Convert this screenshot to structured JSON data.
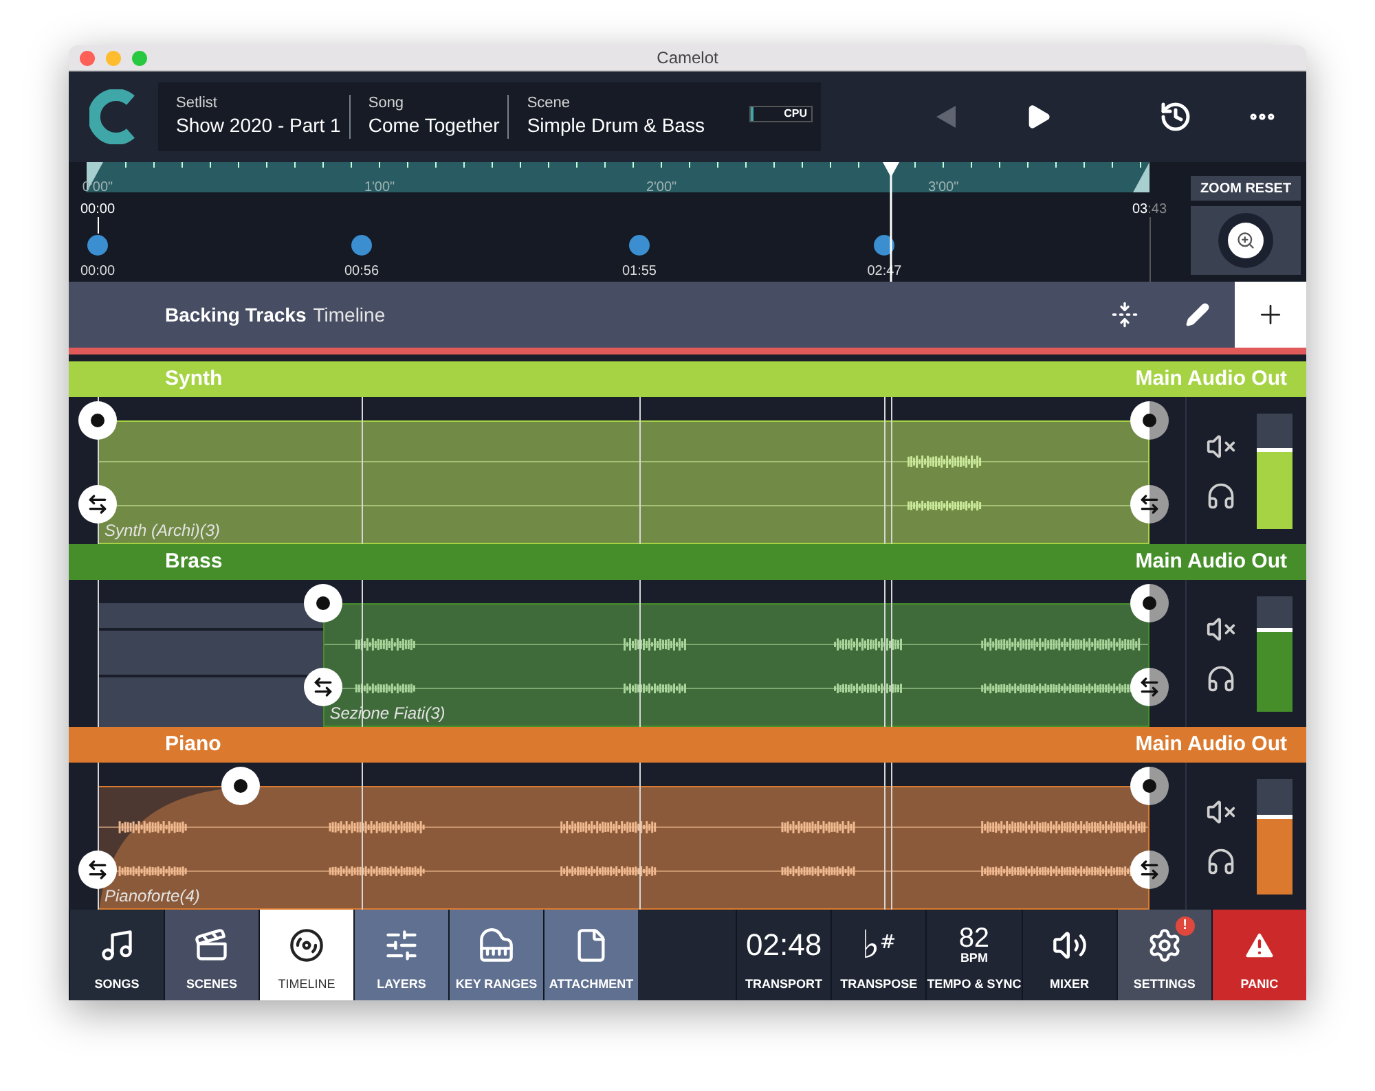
{
  "window": {
    "title": "Camelot"
  },
  "header": {
    "fields": [
      {
        "label": "Setlist",
        "value": "Show 2020 - Part 1"
      },
      {
        "label": "Song",
        "value": "Come Together"
      },
      {
        "label": "Scene",
        "value": "Simple Drum & Bass"
      }
    ],
    "cpu": {
      "label": "CPU",
      "level": 0.05
    }
  },
  "ruler": {
    "ticks": [
      "0'00\"",
      "1'00\"",
      "2'00\"",
      "3'00\""
    ],
    "start": "00:00",
    "end_main": "03",
    "end_rest": ":43",
    "markers": [
      "00:00",
      "00:56",
      "01:55",
      "02:47"
    ],
    "playhead": {
      "level": 0.754
    },
    "zoom_reset": "ZOOM RESET"
  },
  "section": {
    "title": "Backing Tracks",
    "subtitle": "Timeline"
  },
  "tracks": [
    {
      "name": "Synth",
      "output": "Main Audio Out",
      "color": "#a6d344",
      "clip": "Synth (Archi)(3)",
      "level": 0.7
    },
    {
      "name": "Brass",
      "output": "Main Audio Out",
      "color": "#458e2a",
      "clip": "Sezione Fiati(3)",
      "level": 0.72
    },
    {
      "name": "Piano",
      "output": "Main Audio Out",
      "color": "#db7a2e",
      "clip": "Pianoforte(4)",
      "level": 0.68
    }
  ],
  "nav": [
    {
      "kind": "songs",
      "label": "SONGS",
      "selected": false
    },
    {
      "kind": "scenes",
      "label": "SCENES",
      "selected": false
    },
    {
      "kind": "timeline",
      "label": "TIMELINE",
      "selected": true
    },
    {
      "kind": "layers",
      "label": "LAYERS",
      "selected": false
    },
    {
      "kind": "keys",
      "label": "KEY RANGES",
      "selected": false
    },
    {
      "kind": "attachment",
      "label": "ATTACHMENT",
      "selected": false
    }
  ],
  "tools": [
    {
      "kind": "transport",
      "label": "TRANSPORT",
      "value": "02:48"
    },
    {
      "kind": "transpose",
      "label": "TRANSPOSE",
      "value": "♭",
      "sup": "#"
    },
    {
      "kind": "tempo",
      "label": "TEMPO & SYNC",
      "value": "82",
      "unit": "BPM"
    },
    {
      "kind": "mixer",
      "label": "MIXER"
    },
    {
      "kind": "settings",
      "label": "SETTINGS",
      "badge": "!"
    },
    {
      "kind": "panic",
      "label": "PANIC"
    }
  ]
}
